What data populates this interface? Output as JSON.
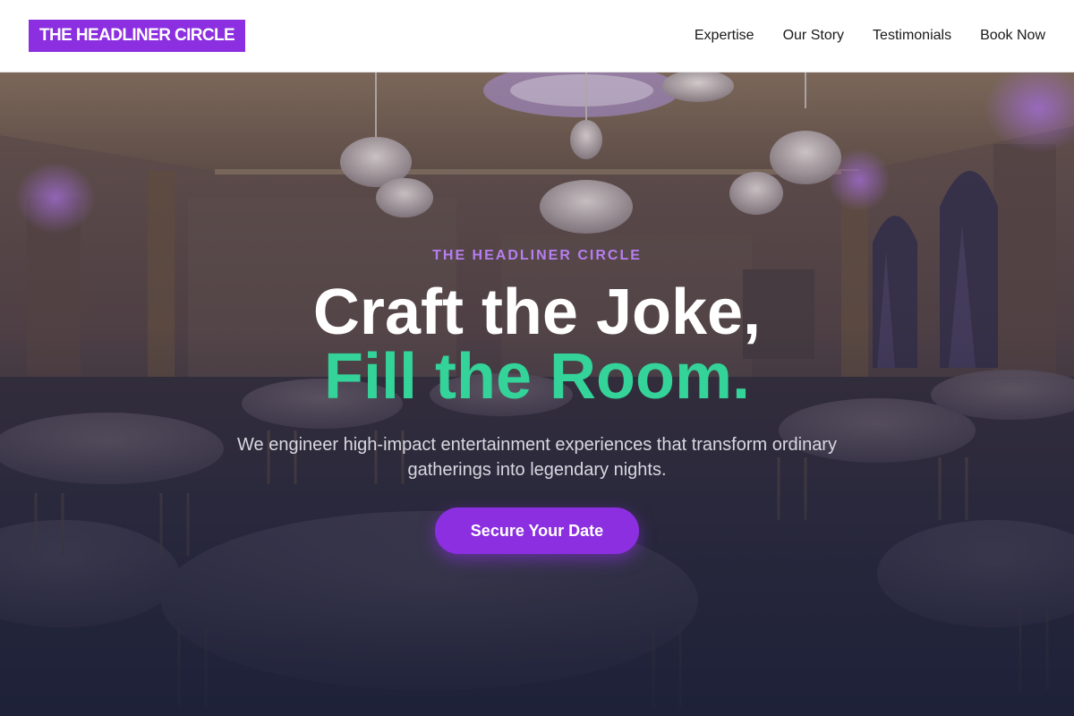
{
  "header": {
    "logo": "THE HEADLINER CIRCLE",
    "nav": [
      {
        "label": "Expertise"
      },
      {
        "label": "Our Story"
      },
      {
        "label": "Testimonials"
      },
      {
        "label": "Book Now"
      }
    ]
  },
  "hero": {
    "eyebrow": "THE HEADLINER CIRCLE",
    "headline": "Craft the Joke,",
    "headline_accent": "Fill the Room.",
    "subtitle": "We engineer high-impact entertainment experiences that transform ordinary gatherings into legendary nights.",
    "cta_label": "Secure Your Date",
    "background_image": "ballroom with chandeliers and round banquet tables"
  },
  "colors": {
    "brand_purple": "#8b2fe0",
    "accent_green": "#34d399",
    "eyebrow_purple": "#b77ef0"
  }
}
